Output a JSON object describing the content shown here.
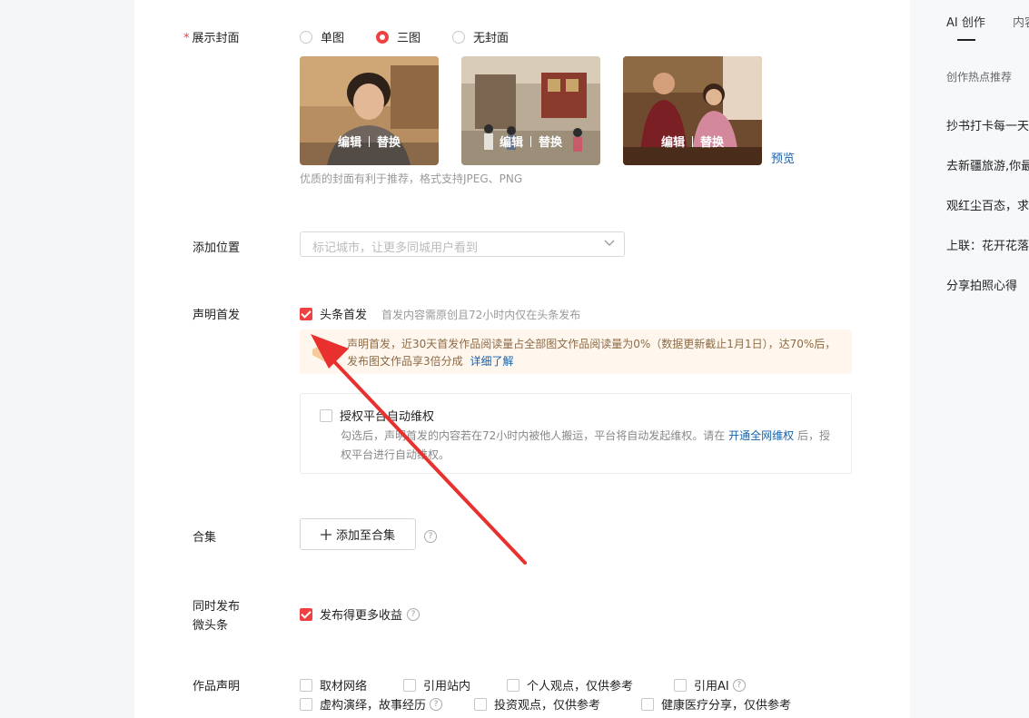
{
  "cover": {
    "label": "展示封面",
    "required_mark": "*",
    "options": [
      {
        "label": "单图",
        "checked": false
      },
      {
        "label": "三图",
        "checked": true
      },
      {
        "label": "无封面",
        "checked": false
      }
    ],
    "edit_label": "编辑",
    "replace_label": "替换",
    "preview_label": "预览",
    "hint": "优质的封面有利于推荐，格式支持JPEG、PNG"
  },
  "location": {
    "label": "添加位置",
    "placeholder": "标记城市，让更多同城用户看到"
  },
  "first_publish": {
    "label": "声明首发",
    "checkbox_label": "头条首发",
    "checked": true,
    "hint": "首发内容需原创且72小时内仅在头条发布",
    "notice": "声明首发，近30天首发作品阅读量占全部图文作品阅读量为0%（数据更新截止1月1日），达70%后，发布图文作品享3倍分成",
    "notice_link": "详细了解",
    "auth_label": "授权平台自动维权",
    "auth_desc_before": "勾选后，声明首发的内容若在72小时内被他人搬运，平台将自动发起维权。请在",
    "auth_desc_link": "开通全网维权",
    "auth_desc_after": "后，授权平台进行自动维权。"
  },
  "collection": {
    "label": "合集",
    "button_label": "添加至合集"
  },
  "micro": {
    "label_line1": "同时发布",
    "label_line2": "微头条",
    "checkbox_label": "发布得更多收益",
    "checked": true
  },
  "declaration": {
    "label": "作品声明",
    "options": [
      "取材网络",
      "引用站内",
      "个人观点，仅供参考",
      "引用AI",
      "虚构演绎，故事经历",
      "投资观点，仅供参考",
      "健康医疗分享，仅供参考"
    ]
  },
  "sidebar": {
    "tabs": [
      "AI 创作",
      "内容"
    ],
    "subtitle": "创作热点推荐",
    "items": [
      "抄书打卡每一天",
      "去新疆旅游,你最想去哪",
      "观红尘百态，求",
      "上联：花开花落",
      "分享拍照心得"
    ]
  },
  "colors": {
    "accent": "#f04142",
    "link": "#1661ab",
    "annotation_arrow": "#e8312f"
  }
}
